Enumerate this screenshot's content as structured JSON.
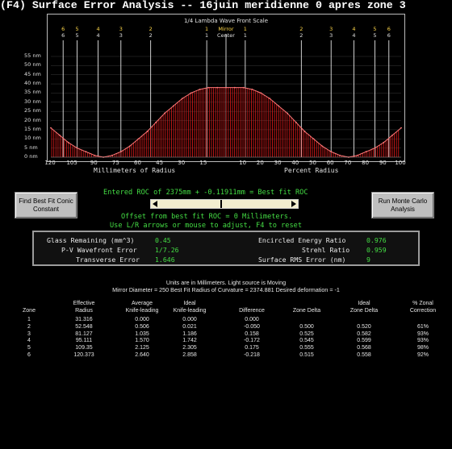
{
  "title": "(F4) Surface Error Analysis -- 16juin meridienne 0 apres zone 3",
  "chart": {
    "header": "1/4 Lambda Wave Front Scale",
    "y_ticks": [
      "55 nm",
      "50 nm",
      "45 nm",
      "40 nm",
      "35 nm",
      "30 nm",
      "25 nm",
      "20 nm",
      "15 nm",
      "10 nm",
      "5 nm",
      "0 nm"
    ],
    "x_ticks_left": [
      "120",
      "105",
      "90",
      "75",
      "60",
      "45",
      "30",
      "15"
    ],
    "x_ticks_right": [
      "10",
      "20",
      "30",
      "40",
      "50",
      "60",
      "70",
      "80",
      "90",
      "100"
    ],
    "x_label_left": "Millimeters of Radius",
    "x_label_right": "Percent Radius",
    "zone_markers_left": [
      "6",
      "5",
      "4",
      "3",
      "2",
      "1"
    ],
    "zone_markers_right": [
      "1",
      "2",
      "3",
      "4",
      "5",
      "6"
    ],
    "center_label_1": "Mirror",
    "center_label_2": "Center",
    "accent_red": "#d01818",
    "accent_pink": "#ff7a7a"
  },
  "chart_data": {
    "type": "area",
    "title": "1/4 Lambda Wave Front Scale",
    "ylabel": "nm",
    "ylim": [
      0,
      55
    ],
    "y_ticks": [
      0,
      5,
      10,
      15,
      20,
      25,
      30,
      35,
      40,
      45,
      50,
      55
    ],
    "xlabel_left": "Millimeters of Radius",
    "xlabel_right": "Percent Radius",
    "series": [
      {
        "x_percent": [
          -100,
          -95,
          -90,
          -85,
          -80,
          -75,
          -70,
          -65,
          -60,
          -55,
          -50,
          -45,
          -40,
          -35,
          -30,
          -25,
          -20,
          -15,
          -10,
          -5,
          0,
          5,
          10,
          15,
          20,
          25,
          30,
          35,
          40,
          45,
          50,
          55,
          60,
          65,
          70,
          75,
          80,
          85,
          90,
          95,
          100
        ],
        "values": [
          16,
          12,
          8,
          5,
          3,
          1,
          0,
          1,
          3,
          6,
          10,
          14,
          19,
          24,
          28,
          32,
          35,
          37,
          38,
          38,
          38,
          38,
          38,
          37,
          35,
          32,
          28,
          24,
          19,
          14,
          10,
          6,
          3,
          1,
          0,
          1,
          3,
          5,
          8,
          12,
          16
        ]
      }
    ]
  },
  "buttons": {
    "find_best": "Find Best Fit Conic Constant",
    "run_monte": "Run Monte Carlo Analysis"
  },
  "roc": {
    "entered": "Entered ROC of 2375mm + -0.11911mm = Best fit ROC",
    "offset": "Offset from best fit ROC = 0 Millimeters.",
    "hint": "Use L/R arrows or mouse to adjust, F4 to reset"
  },
  "results": {
    "glass_label": "Glass Remaining (mm^3)",
    "glass_value": "0.45",
    "pv_label": "P-V Wavefront Error",
    "pv_value": "1/7.26",
    "transverse_label": "Transverse Error",
    "transverse_value": "1.646",
    "encircled_label": "Encircled Energy Ratio",
    "encircled_value": "0.976",
    "strehl_label": "Strehl Ratio",
    "strehl_value": "0.959",
    "rms_label": "Surface RMS Error (nm)",
    "rms_value": "9"
  },
  "lower": {
    "line1": "Units are in Millimeters. Light source is Moving",
    "line2": "Mirror Diameter = 250   Best Fit Radius of Curvature = 2374.881   Desired deformation = -1",
    "columns": [
      {
        "h1": "",
        "h2": "Zone"
      },
      {
        "h1": "Effective",
        "h2": "Radius"
      },
      {
        "h1": "Average",
        "h2": "Knife-leading"
      },
      {
        "h1": "Ideal",
        "h2": "Knife-leading"
      },
      {
        "h1": "",
        "h2": "Difference"
      },
      {
        "h1": "",
        "h2": "Zone Delta"
      },
      {
        "h1": "Ideal",
        "h2": "Zone Delta"
      },
      {
        "h1": "% Zonal",
        "h2": "Correction"
      }
    ],
    "rows": [
      [
        "1",
        "31.316",
        "0.000",
        "0.000",
        "0.000",
        "",
        "",
        ""
      ],
      [
        "2",
        "52.548",
        "0.506",
        "0.021",
        "-0.050",
        "0.500",
        "0.520",
        "61%"
      ],
      [
        "3",
        "81.127",
        "1.035",
        "1.186",
        "0.158",
        "0.525",
        "0.582",
        "93%"
      ],
      [
        "4",
        "95.111",
        "1.570",
        "1.742",
        "-0.172",
        "0.545",
        "0.599",
        "93%"
      ],
      [
        "5",
        "109.35",
        "2.125",
        "2.305",
        "0.175",
        "0.555",
        "0.568",
        "98%"
      ],
      [
        "6",
        "120.373",
        "2.640",
        "2.858",
        "-0.218",
        "0.515",
        "0.558",
        "92%"
      ]
    ]
  }
}
